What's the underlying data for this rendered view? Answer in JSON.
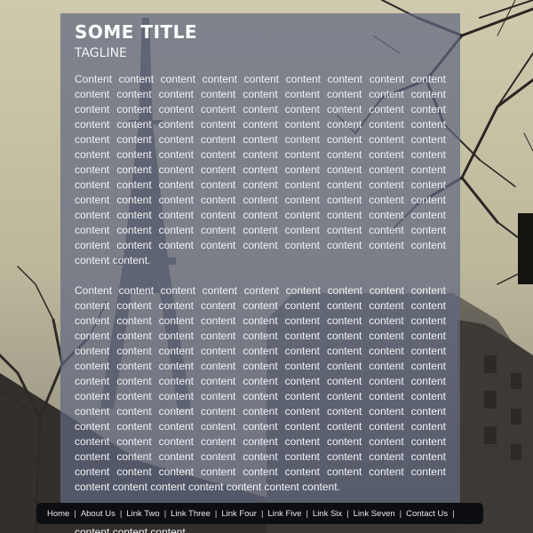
{
  "header": {
    "title": "SOME TITLE",
    "tagline": "TAGLINE"
  },
  "content": {
    "paragraphs": [
      "Content content content content content content content content content content content content content content content content content content content content content content content content content content content content content content content content content content content content content content content content content content content content content content content content content content content content content content content content content content content content content content content content content content content content content content content content content content content content content content content content content content content content content content content content content content content content content content content content content content content content content content content content content content content content content content.",
      "Content content content content content content content content content content content content content content content content content content content content content content content content content content content content content content content content content content content content content content content content content content content content content content content content content content content content content content content content content content content content content content content content content content content content content content content content content content content content content content content content content content content content content content content content content content content content content content content content content content content content content content content content content content content content content content content content content content content content content content content content content content content content.",
      "Content content content content content content content content content content content content."
    ]
  },
  "nav": {
    "items": [
      {
        "label": "Home"
      },
      {
        "label": "About Us"
      },
      {
        "label": "Link Two"
      },
      {
        "label": "Link Three"
      },
      {
        "label": "Link Four"
      },
      {
        "label": "Link Five"
      },
      {
        "label": "Link Six"
      },
      {
        "label": "Link Seven"
      },
      {
        "label": "Contact Us"
      }
    ],
    "separator": "|"
  },
  "colors": {
    "panel": "#606880",
    "nav_bg": "#0d0e11",
    "text": "#f3f3f6"
  }
}
